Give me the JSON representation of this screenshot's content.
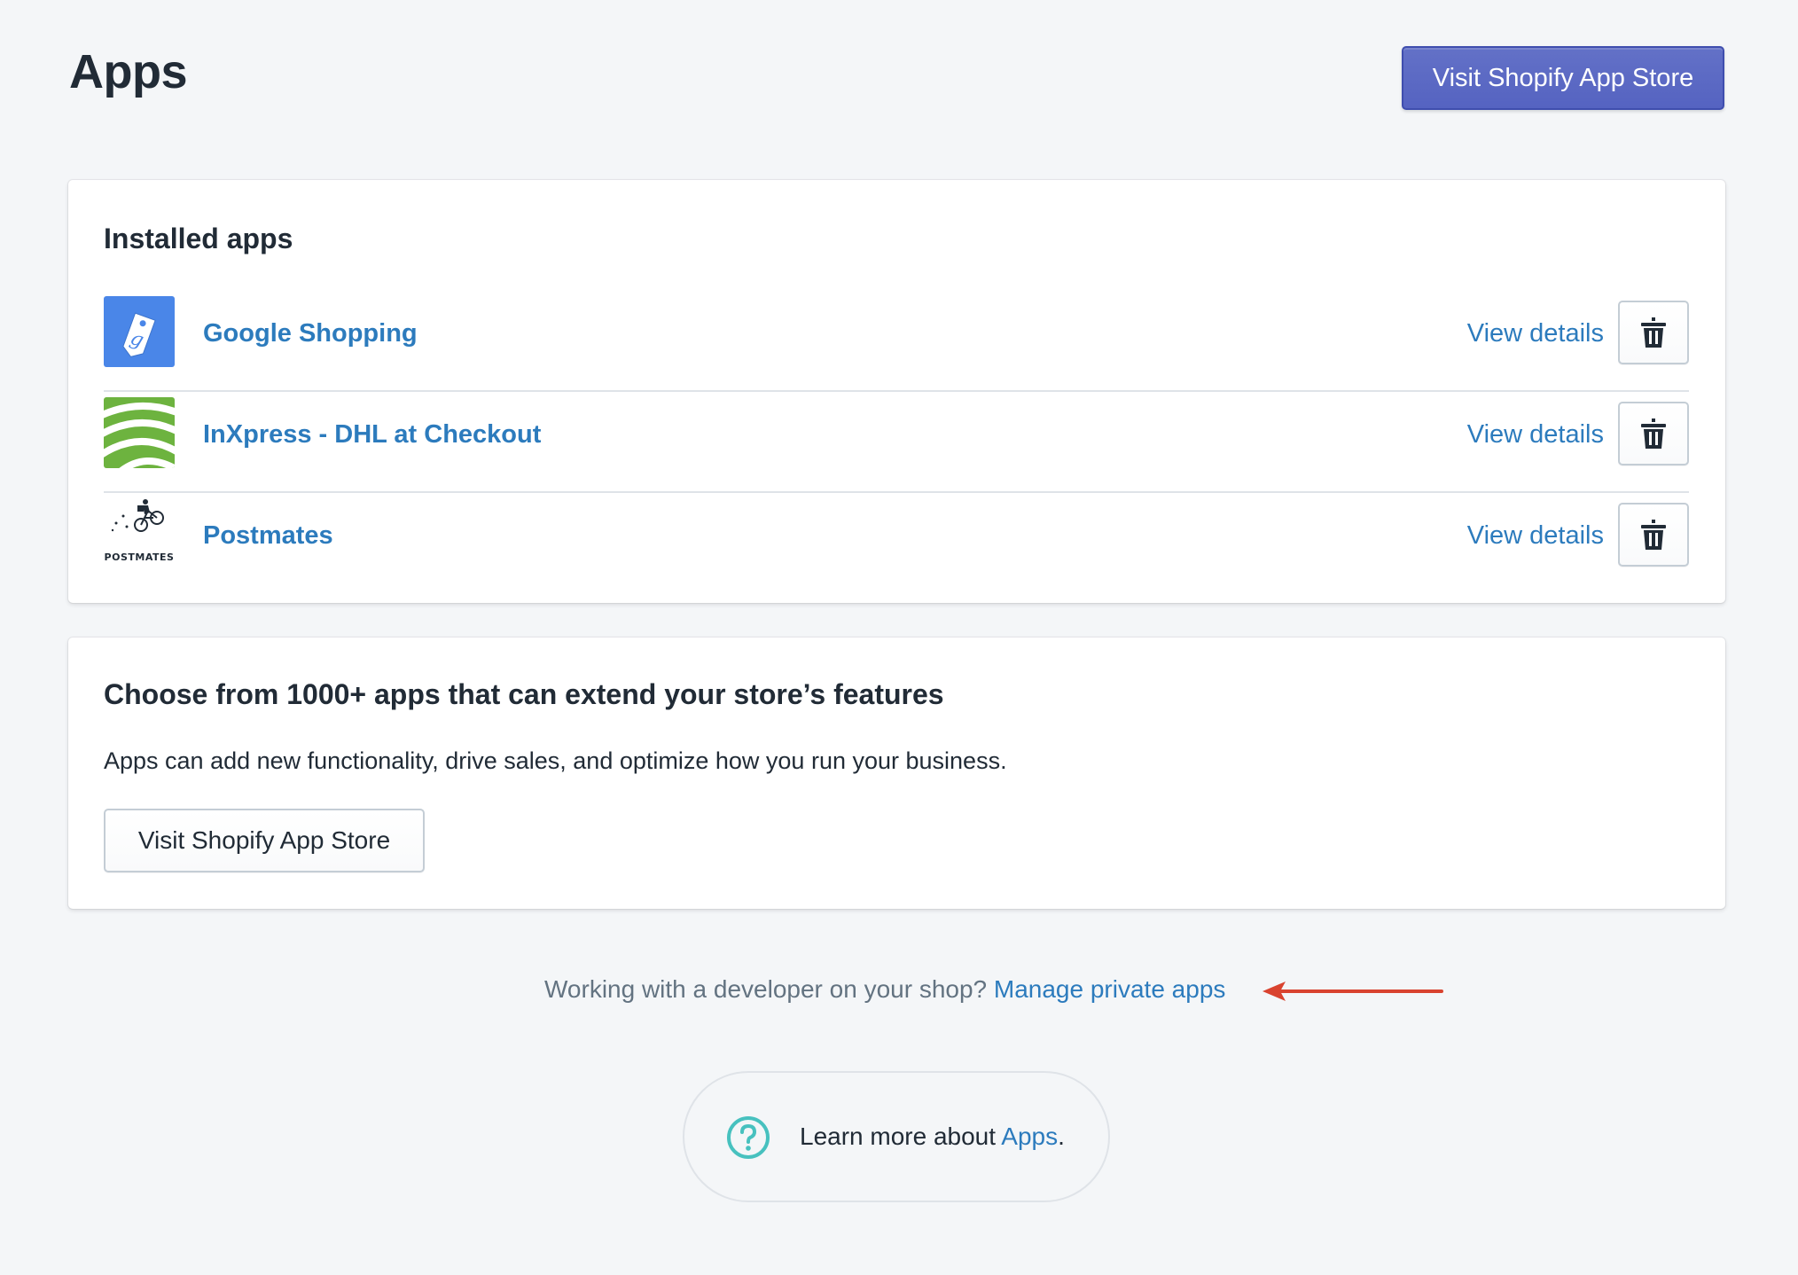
{
  "header": {
    "title": "Apps",
    "primary_action": "Visit Shopify App Store"
  },
  "installed": {
    "title": "Installed apps",
    "apps": [
      {
        "name": "Google Shopping",
        "view_details": "View details",
        "logo": "google-shopping-tag-icon",
        "logo_color": "#4a86e8"
      },
      {
        "name": "InXpress - DHL at Checkout",
        "view_details": "View details",
        "logo": "inxpress-stripes-logo",
        "logo_color": "#6db33f"
      },
      {
        "name": "Postmates",
        "view_details": "View details",
        "logo": "postmates-courier-logo",
        "logo_text": "POSTMATES"
      }
    ]
  },
  "choose": {
    "title": "Choose from 1000+ apps that can extend your store’s features",
    "description": "Apps can add new functionality, drive sales, and optimize how you run your business.",
    "button": "Visit Shopify App Store"
  },
  "footer": {
    "dev_question": "Working with a developer on your shop?",
    "dev_link": "Manage private apps",
    "learn_prefix": "Learn more about ",
    "learn_link": "Apps",
    "learn_suffix": "."
  },
  "colors": {
    "primary": "#5c6ac4",
    "link": "#2c7bbd",
    "annotation_arrow": "#d9432f",
    "help_icon": "#47c1bf"
  }
}
